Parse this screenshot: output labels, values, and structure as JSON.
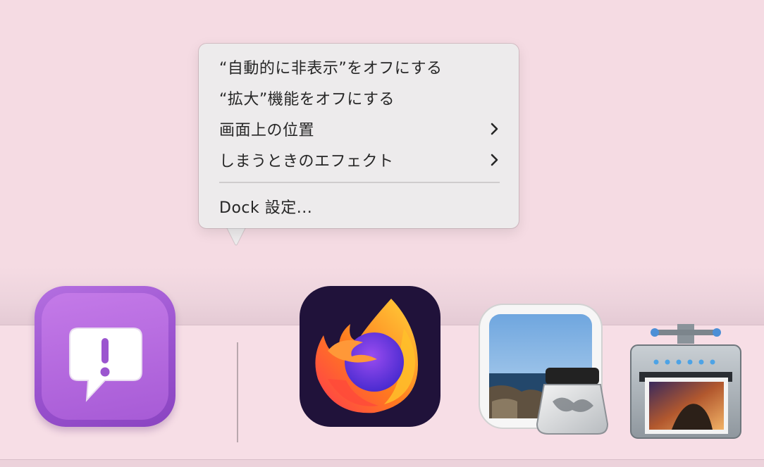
{
  "context_menu": {
    "items": [
      {
        "label": "“自動的に非表示”をオフにする",
        "has_submenu": false
      },
      {
        "label": "“拡大”機能をオフにする",
        "has_submenu": false
      },
      {
        "label": "画面上の位置",
        "has_submenu": true
      },
      {
        "label": "しまうときのエフェクト",
        "has_submenu": true
      }
    ],
    "footer_item": {
      "label": "Dock 設定..."
    }
  },
  "dock": {
    "apps": [
      {
        "icon": "feedback-assistant-icon",
        "color": "#a75bd6"
      },
      {
        "icon": "firefox-icon",
        "color": "#20123a"
      },
      {
        "icon": "preview-icon",
        "color": "#7fb4e3"
      },
      {
        "icon": "image-capture-icon",
        "color": "#9aa3ab"
      }
    ]
  },
  "colors": {
    "desktop": "#f5dbe3",
    "menu_background": "#edebec",
    "menu_text": "#262626"
  }
}
